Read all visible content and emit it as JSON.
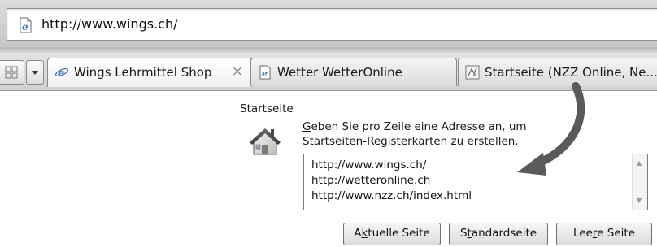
{
  "address_bar": {
    "url": "http://www.wings.ch/",
    "icon": "ie-page-icon"
  },
  "tabs": [
    {
      "label": "Wings Lehrmittel Shop",
      "icon": "ie-page-icon",
      "active": true,
      "close": "×"
    },
    {
      "label": "Wetter WetterOnline",
      "icon": "ie-page-icon",
      "active": false
    },
    {
      "label": "Startseite (NZZ Online, Ne...",
      "icon": "nzz-favicon-icon",
      "active": false
    }
  ],
  "homepage": {
    "group_title": "Startseite",
    "description_line1": "Geben Sie pro Zeile eine Adresse an, um",
    "description_line2": "Startseiten-Registerkarten zu erstellen.",
    "urls": [
      "http://www.wings.ch/",
      "http://wetteronline.ch",
      "http://www.nzz.ch/index.html"
    ],
    "buttons": {
      "current": {
        "before": "A",
        "accel": "k",
        "after": "tuelle Seite"
      },
      "default": {
        "before": "S",
        "accel": "t",
        "after": "andardseite"
      },
      "blank": {
        "before": "Lee",
        "accel": "r",
        "after": "e Seite"
      }
    }
  },
  "colors": {
    "arrow": "#5a5a5a",
    "ie_blue": "#3a6fb5"
  }
}
